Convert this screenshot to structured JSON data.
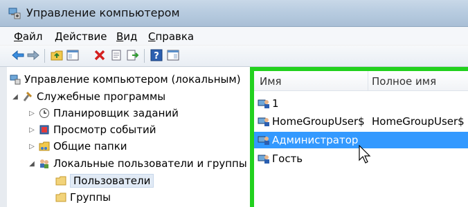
{
  "window": {
    "title": "Управление компьютером"
  },
  "menu": [
    {
      "prefix": "",
      "accel": "Ф",
      "rest": "айл"
    },
    {
      "prefix": "",
      "accel": "Д",
      "rest": "ействие"
    },
    {
      "prefix": "",
      "accel": "В",
      "rest": "ид"
    },
    {
      "prefix": "",
      "accel": "С",
      "rest": "правка"
    }
  ],
  "tree": {
    "root": "Управление компьютером (локальным)",
    "system_tools": "Служебные программы",
    "task_scheduler": "Планировщик заданий",
    "event_viewer": "Просмотр событий",
    "shared_folders": "Общие папки",
    "local_users_groups": "Локальные пользователи и группы",
    "users": "Пользователи",
    "groups": "Группы"
  },
  "list": {
    "columns": {
      "name": "Имя",
      "full_name": "Полное имя"
    },
    "rows": [
      {
        "name": "1",
        "full_name": ""
      },
      {
        "name": "HomeGroupUser$",
        "full_name": "HomeGroupUser$"
      },
      {
        "name": "Администратор",
        "full_name": ""
      },
      {
        "name": "Гость",
        "full_name": ""
      }
    ],
    "selected_index": 2
  },
  "colors": {
    "highlight_border": "#22d11e",
    "selection": "#3399ff"
  },
  "icons": {
    "toolbar": [
      "back-arrow-icon",
      "forward-arrow-icon",
      "up-folder-icon",
      "show-hide-tree-icon",
      "delete-icon",
      "properties-icon",
      "export-list-icon",
      "help-icon",
      "show-hide-action-pane-icon"
    ]
  }
}
